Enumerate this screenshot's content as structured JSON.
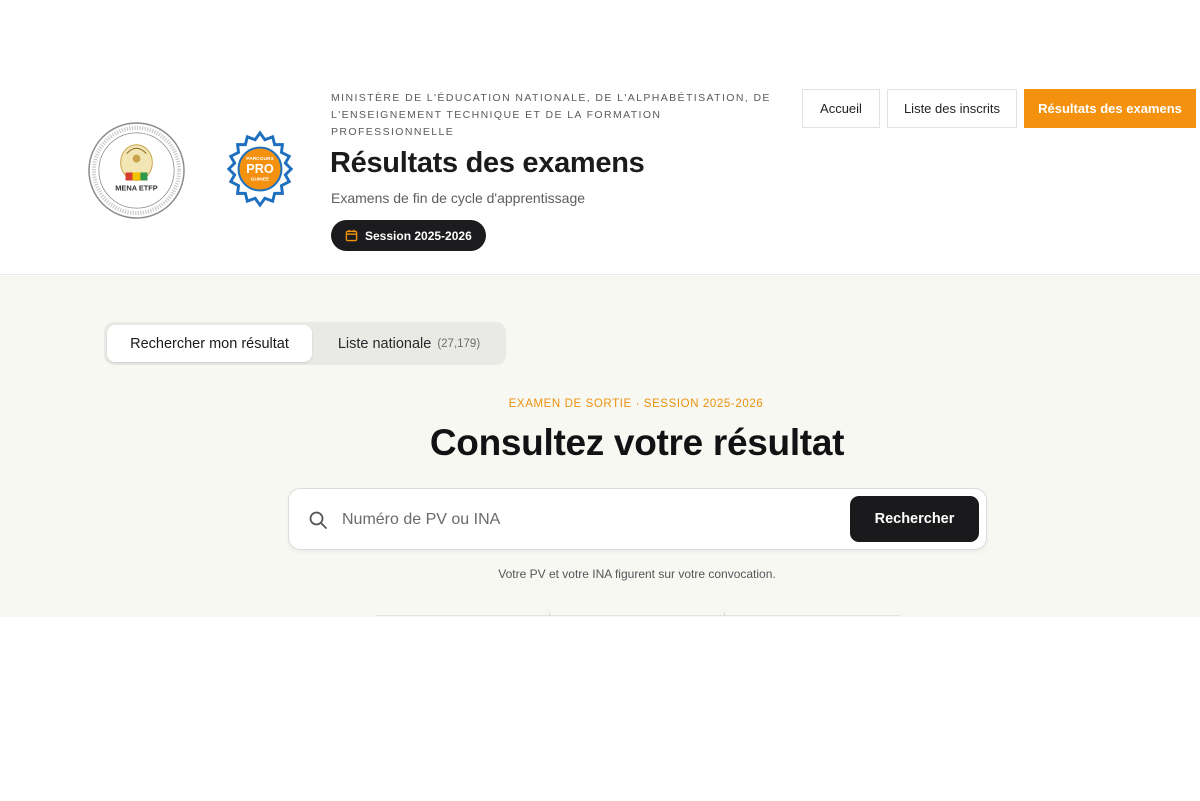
{
  "header": {
    "ministry": "MINISTÈRE DE L'ÉDUCATION NATIONALE, DE L'ALPHABÉTISATION, DE L'ENSEIGNEMENT TECHNIQUE ET DE LA FORMATION PROFESSIONNELLE",
    "title": "Résultats des examens",
    "subtitle": "Examens de fin de cycle d'apprentissage",
    "session_badge": "Session 2025-2026",
    "logos": {
      "mena_text": "MENA ETFP",
      "pro_top": "PARCOURS",
      "pro_main": "PRO",
      "pro_bottom": "GUINEE"
    }
  },
  "nav": {
    "home": "Accueil",
    "registered_list": "Liste des inscrits",
    "exam_results": "Résultats des examens"
  },
  "tabs": {
    "search_result": "Rechercher mon résultat",
    "national_list": "Liste nationale",
    "national_count": "(27,179)"
  },
  "main": {
    "exam_label": "EXAMEN DE SORTIE · SESSION 2025-2026",
    "headline": "Consultez votre résultat",
    "search_placeholder": "Numéro de PV ou INA",
    "search_button": "Rechercher",
    "hint": "Votre PV et votre INA figurent sur votre convocation."
  },
  "colors": {
    "accent": "#f4920f",
    "dark": "#1b1b1d",
    "background": "#f8f8f3"
  },
  "icons": [
    "calendar-icon",
    "search-icon"
  ]
}
